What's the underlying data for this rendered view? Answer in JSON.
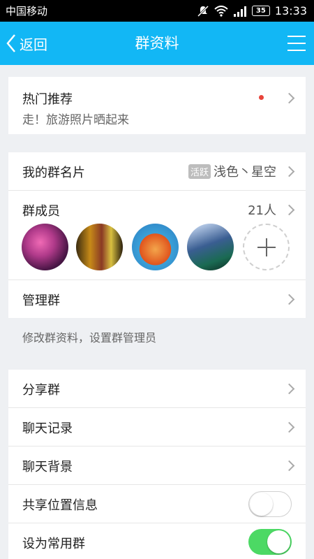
{
  "status_bar": {
    "carrier": "中国移动",
    "battery": "35",
    "time": "13:33",
    "icons": [
      "mute-icon",
      "wifi-icon",
      "signal-icon",
      "battery-icon"
    ]
  },
  "header": {
    "back_label": "返回",
    "title": "群资料",
    "menu_icon": "menu-icon",
    "bg_color": "#12b7f5"
  },
  "recommend": {
    "title": "热门推荐",
    "subtitle": "走！旅游照片晒起来",
    "dot_color": "#e8433a"
  },
  "group_card": {
    "label": "我的群名片",
    "badge": "活跃",
    "value": "浅色丶星空"
  },
  "members": {
    "label": "群成员",
    "count": "21人",
    "add_icon": "plus-icon"
  },
  "manage": {
    "label": "管理群",
    "hint": "修改群资料，设置群管理员"
  },
  "share": {
    "label": "分享群"
  },
  "chat_history": {
    "label": "聊天记录"
  },
  "chat_bg": {
    "label": "聊天背景"
  },
  "location": {
    "label": "共享位置信息",
    "enabled": false
  },
  "frequent": {
    "label": "设为常用群",
    "enabled": true,
    "on_color": "#4cd964"
  }
}
